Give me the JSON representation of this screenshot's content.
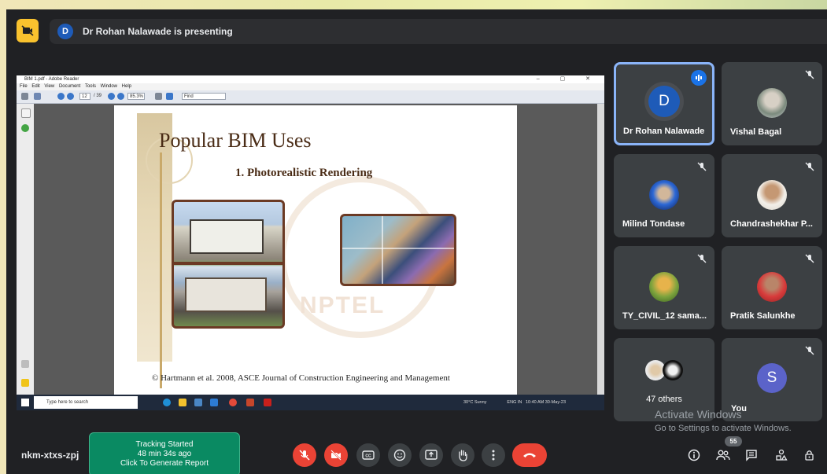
{
  "presenting": {
    "avatar_letter": "D",
    "text": "Dr Rohan Nalawade is presenting"
  },
  "shared_screen": {
    "window_title": "BIM 1.pdf - Adobe Reader",
    "menu": [
      "File",
      "Edit",
      "View",
      "Document",
      "Tools",
      "Window",
      "Help"
    ],
    "page_number": "12",
    "page_total": "/ 39",
    "zoom": "85.3%",
    "find_placeholder": "Find",
    "slide_title": "Popular BIM Uses",
    "slide_subtitle": "1. Photorealistic Rendering",
    "watermark_text": "NPTEL",
    "citation": "© Hartmann et al. 2008, ASCE Journal of Construction Engineering and Management",
    "taskbar": {
      "search_placeholder": "Type here to search",
      "weather": "30°C  Sunny",
      "lang": "ENG IN",
      "time": "10:40 AM",
      "date": "30-May-23"
    }
  },
  "participants": [
    {
      "name": "Dr Rohan Nalawade",
      "avatar": "D",
      "active_speaker": true
    },
    {
      "name": "Vishal Bagal",
      "avatar": "photo",
      "muted": true
    },
    {
      "name": "Milind Tondase",
      "avatar": "photo",
      "muted": true
    },
    {
      "name": "Chandrashekhar P...",
      "avatar": "photo",
      "muted": true
    },
    {
      "name": "TY_CIVIL_12 sama...",
      "avatar": "photo",
      "muted": true
    },
    {
      "name": "Pratik Salunkhe",
      "avatar": "photo",
      "muted": true
    },
    {
      "name": "47 others",
      "avatar": "stack"
    },
    {
      "name": "You",
      "avatar": "S",
      "muted": true
    }
  ],
  "activate_windows": {
    "title": "Activate Windows",
    "subtitle": "Go to Settings to activate Windows."
  },
  "bottom": {
    "meeting_code": "nkm-xtxs-zpj",
    "tracking_line1": "Tracking Started",
    "tracking_line2": "48 min 34s ago",
    "tracking_line3": "Click To Generate Report",
    "people_count": "55"
  },
  "colors": {
    "meet_bg": "#202124",
    "tile_bg": "#3c4043",
    "active_border": "#8ab4f8",
    "danger": "#ea4335",
    "tracking_green": "#0a8a62"
  }
}
